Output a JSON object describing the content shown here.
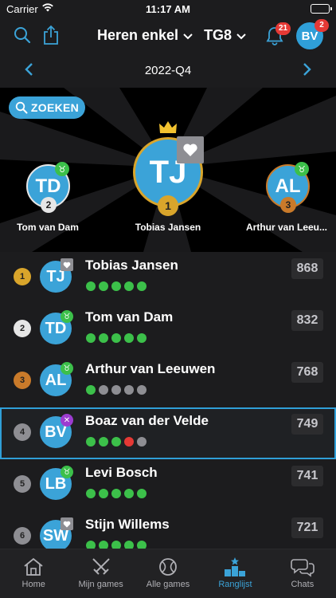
{
  "status_bar": {
    "carrier": "Carrier",
    "time": "11:17 AM"
  },
  "header": {
    "competition": "Heren enkel",
    "group": "TG8",
    "notifications_count": "21",
    "user_initials": "BV",
    "user_badge_count": "2"
  },
  "period": {
    "label": "2022-Q4"
  },
  "search": {
    "label": "ZOEKEN"
  },
  "podium": [
    {
      "rank": "1",
      "initials": "TJ",
      "name": "Tobias Jansen"
    },
    {
      "rank": "2",
      "initials": "TD",
      "name": "Tom van Dam"
    },
    {
      "rank": "3",
      "initials": "AL",
      "name": "Arthur van Leeu..."
    }
  ],
  "ranking": [
    {
      "rank": "1",
      "initials": "TJ",
      "name": "Tobias Jansen",
      "score": "868",
      "form": [
        "win",
        "win",
        "win",
        "win",
        "win"
      ],
      "badge": "heart"
    },
    {
      "rank": "2",
      "initials": "TD",
      "name": "Tom van Dam",
      "score": "832",
      "form": [
        "win",
        "win",
        "win",
        "win",
        "win"
      ],
      "badge": "green"
    },
    {
      "rank": "3",
      "initials": "AL",
      "name": "Arthur van Leeuwen",
      "score": "768",
      "form": [
        "win",
        "none",
        "none",
        "none",
        "none"
      ],
      "badge": "green"
    },
    {
      "rank": "4",
      "initials": "BV",
      "name": "Boaz van der Velde",
      "score": "749",
      "form": [
        "win",
        "win",
        "win",
        "loss",
        "none"
      ],
      "badge": "purple"
    },
    {
      "rank": "5",
      "initials": "LB",
      "name": "Levi Bosch",
      "score": "741",
      "form": [
        "win",
        "win",
        "win",
        "win",
        "win"
      ],
      "badge": "green"
    },
    {
      "rank": "6",
      "initials": "SW",
      "name": "Stijn Willems",
      "score": "721",
      "form": [
        "win",
        "win",
        "win",
        "win",
        "win"
      ],
      "badge": "heart"
    }
  ],
  "tabs": [
    {
      "label": "Home",
      "icon": "home-icon"
    },
    {
      "label": "Mijn games",
      "icon": "swords-icon"
    },
    {
      "label": "Alle games",
      "icon": "ball-icon"
    },
    {
      "label": "Ranglijst",
      "icon": "podium-icon",
      "active": true
    },
    {
      "label": "Chats",
      "icon": "chat-icon"
    }
  ],
  "colors": {
    "accent": "#3ba3d8",
    "win": "#3cc04a",
    "loss": "#e53935",
    "none": "#8e8e93",
    "gold": "#d9a52b",
    "silver": "#e6e6e6",
    "bronze": "#c97a2a",
    "badge_red": "#e53935"
  }
}
